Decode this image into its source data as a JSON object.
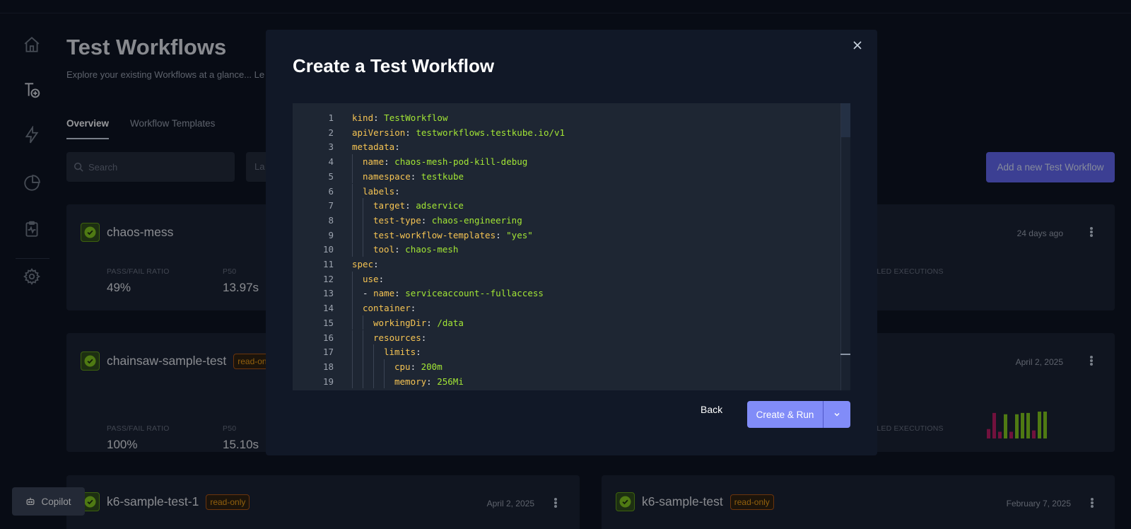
{
  "page": {
    "title": "Test Workflows",
    "subtitle": "Explore your existing Workflows at a glance... Le",
    "tabs": [
      {
        "label": "Overview"
      },
      {
        "label": "Workflow Templates"
      }
    ],
    "search_placeholder": "Search",
    "filter_text": "La",
    "add_button": "Add a new Test Workflow"
  },
  "cards": [
    {
      "name": "chaos-mess",
      "date": "24 days ago",
      "pass_fail_label": "PASS/FAIL RATIO",
      "pass_fail": "49%",
      "p50_label": "P50",
      "p50": "13.97s",
      "failed_label": "AILED EXECUTIONS"
    },
    {
      "name": "chainsaw-sample-test",
      "badge": "read-only",
      "badge_partial": "read-onl",
      "date": "April 2, 2025",
      "pass_fail_label": "PASS/FAIL RATIO",
      "pass_fail": "100%",
      "p50_label": "P50",
      "p50": "15.10s",
      "failed_label": "AILED EXECUTIONS"
    },
    {
      "name": "k6-sample-test-1",
      "badge": "read-only",
      "date": "April 2, 2025"
    },
    {
      "name": "k6-sample-test",
      "badge": "read-only",
      "date": "February 7, 2025"
    }
  ],
  "execution_bars": [
    {
      "value": 0.35,
      "status": "failed"
    },
    {
      "value": 0.95,
      "status": "failed"
    },
    {
      "value": 0.25,
      "status": "failed"
    },
    {
      "value": 0.9,
      "status": "passed"
    },
    {
      "value": 0.25,
      "status": "failed"
    },
    {
      "value": 0.9,
      "status": "passed"
    },
    {
      "value": 0.95,
      "status": "passed"
    },
    {
      "value": 0.95,
      "status": "passed"
    },
    {
      "value": 0.3,
      "status": "failed"
    },
    {
      "value": 1.0,
      "status": "passed"
    },
    {
      "value": 1.0,
      "status": "passed"
    }
  ],
  "colors": {
    "passed": "#84cc16",
    "failed": "#be185d",
    "accent": "#818cf8"
  },
  "modal": {
    "title": "Create a Test Workflow",
    "back_label": "Back",
    "create_label": "Create & Run",
    "code_lines": [
      {
        "n": 1,
        "indent": 0,
        "key": "kind",
        "value": "TestWorkflow"
      },
      {
        "n": 2,
        "indent": 0,
        "key": "apiVersion",
        "value": "testworkflows.testkube.io/v1"
      },
      {
        "n": 3,
        "indent": 0,
        "key": "metadata",
        "value": ""
      },
      {
        "n": 4,
        "indent": 1,
        "key": "name",
        "value": "chaos-mesh-pod-kill-debug"
      },
      {
        "n": 5,
        "indent": 1,
        "key": "namespace",
        "value": "testkube"
      },
      {
        "n": 6,
        "indent": 1,
        "key": "labels",
        "value": ""
      },
      {
        "n": 7,
        "indent": 2,
        "key": "target",
        "value": "adservice"
      },
      {
        "n": 8,
        "indent": 2,
        "key": "test-type",
        "value": "chaos-engineering"
      },
      {
        "n": 9,
        "indent": 2,
        "key": "test-workflow-templates",
        "value": "\"yes\""
      },
      {
        "n": 10,
        "indent": 2,
        "key": "tool",
        "value": "chaos-mesh"
      },
      {
        "n": 11,
        "indent": 0,
        "key": "spec",
        "value": ""
      },
      {
        "n": 12,
        "indent": 1,
        "key": "use",
        "value": ""
      },
      {
        "n": 13,
        "indent": 1,
        "dash": true,
        "key": "name",
        "value": "serviceaccount--fullaccess"
      },
      {
        "n": 14,
        "indent": 1,
        "key": "container",
        "value": ""
      },
      {
        "n": 15,
        "indent": 2,
        "key": "workingDir",
        "value": "/data"
      },
      {
        "n": 16,
        "indent": 2,
        "key": "resources",
        "value": ""
      },
      {
        "n": 17,
        "indent": 3,
        "key": "limits",
        "value": ""
      },
      {
        "n": 18,
        "indent": 4,
        "key": "cpu",
        "value": "200m"
      },
      {
        "n": 19,
        "indent": 4,
        "key": "memory",
        "value": "256Mi"
      }
    ]
  },
  "copilot_label": "Copilot"
}
